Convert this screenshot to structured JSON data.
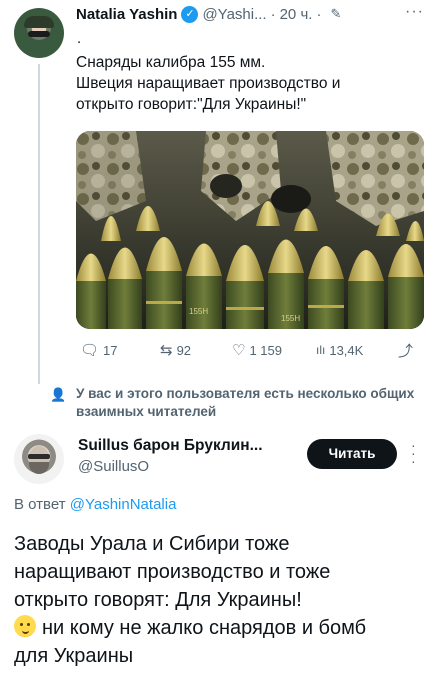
{
  "tweet": {
    "author_name": "Natalia Yashin",
    "author_handle": "@Yashi...",
    "time": "20 ч.",
    "separator": "·",
    "dot_line": ".",
    "text_lines": [
      "Снаряды калибра 155 мм.",
      "Швеция наращивает производство и",
      "открыто говорит:\"Для Украины!\""
    ],
    "image_marking": "155H",
    "stats": {
      "replies": "17",
      "retweets": "92",
      "likes": "1 159",
      "views": "13,4K"
    },
    "mutual_followers_note": "У вас и этого пользователя есть несколько общих взаимных читателей"
  },
  "reply": {
    "author_name": "Suillus барон Бруклин...",
    "author_handle": "@SuillusO",
    "follow_label": "Читать",
    "in_reply_prefix": "В ответ",
    "in_reply_handle": "@YashinNatalia",
    "text_lines": [
      "Заводы Урала и Сибири тоже",
      "наращивают производство и тоже",
      "открыто говорят: Для Украины!",
      "ни кому не жалко снарядов и бомб",
      "для Украины"
    ]
  },
  "icons": {
    "verified": "verified-badge-icon",
    "edit": "edit-pencil-icon",
    "more": "more-dots-icon",
    "reply": "reply-bubble-icon",
    "retweet": "retweet-icon",
    "like": "heart-icon",
    "views": "views-bars-icon",
    "share": "share-icon",
    "mutual": "person-icon",
    "emoji": "thinking-face-emoji"
  },
  "colors": {
    "accent": "#1d9bf0",
    "text": "#0f1419",
    "muted": "#536471",
    "button": "#0f1419"
  }
}
